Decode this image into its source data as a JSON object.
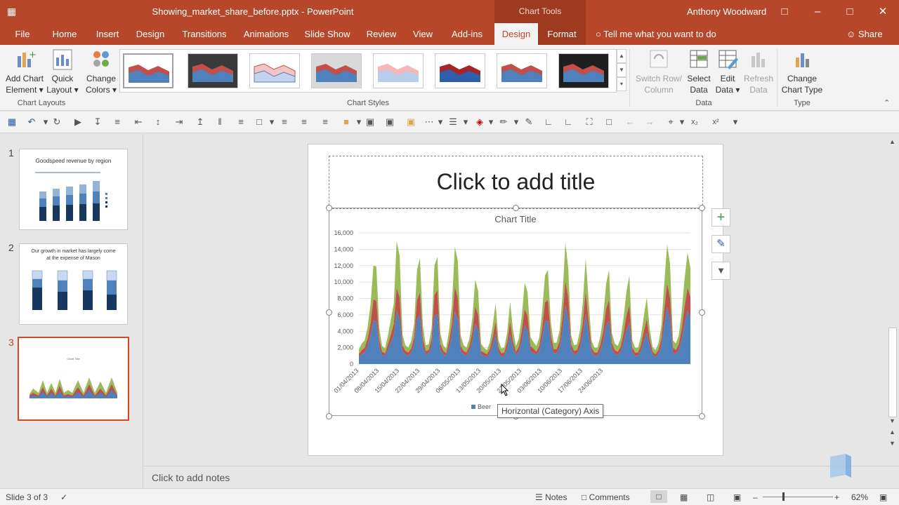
{
  "titlebar": {
    "doc_title": "Showing_market_share_before.pptx - PowerPoint",
    "contextual_group": "Chart Tools",
    "user": "Anthony Woodward",
    "save_icon": "save-icon",
    "accent": "#b7472a",
    "context_color": "#9e3a20"
  },
  "tabs": [
    {
      "label": "File"
    },
    {
      "label": "Home"
    },
    {
      "label": "Insert"
    },
    {
      "label": "Design"
    },
    {
      "label": "Transitions"
    },
    {
      "label": "Animations"
    },
    {
      "label": "Slide Show"
    },
    {
      "label": "Review"
    },
    {
      "label": "View"
    },
    {
      "label": "Add-ins"
    },
    {
      "label": "Design"
    },
    {
      "label": "Format"
    }
  ],
  "tell_me": "Tell me what you want to do",
  "share": "Share",
  "ribbon": {
    "add_chart_element": {
      "line1": "Add Chart",
      "line2": "Element ▾"
    },
    "quick_layout": {
      "line1": "Quick",
      "line2": "Layout ▾"
    },
    "change_colors": {
      "line1": "Change",
      "line2": "Colors ▾"
    },
    "group_chart_layouts": "Chart Layouts",
    "group_chart_styles": "Chart Styles",
    "switch_row_col": {
      "line1": "Switch Row/",
      "line2": "Column"
    },
    "select_data": {
      "line1": "Select",
      "line2": "Data"
    },
    "edit_data": {
      "line1": "Edit",
      "line2": "Data ▾"
    },
    "refresh_data": {
      "line1": "Refresh",
      "line2": "Data"
    },
    "group_data": "Data",
    "change_chart_type": {
      "line1": "Change",
      "line2": "Chart Type"
    },
    "group_type": "Type"
  },
  "slides": {
    "numbers": [
      "1",
      "2",
      "3"
    ],
    "s1_title": "Goodspeed revenue by region",
    "s2_title_l1": "Our growth in market has largely come",
    "s2_title_l2": "at the expense of Mason",
    "s3_title": "Chart Title"
  },
  "slide": {
    "title_placeholder": "Click to add title"
  },
  "chart_data": {
    "type": "area",
    "stacked": true,
    "title": "Chart Title",
    "ylim": [
      0,
      16000
    ],
    "yticks": [
      "0",
      "2,000",
      "4,000",
      "6,000",
      "8,000",
      "10,000",
      "12,000",
      "14,000",
      "16,000"
    ],
    "x_tick_labels": [
      "01/04/2013",
      "08/04/2013",
      "15/04/2013",
      "22/04/2013",
      "29/04/2013",
      "06/05/2013",
      "13/05/2013",
      "20/05/2013",
      "27/05/2013",
      "03/06/2013",
      "10/06/2013",
      "17/06/2013",
      "24/06/2013"
    ],
    "legend_visible": "Beer",
    "legend_position": "bottom",
    "series": [
      {
        "name": "Beer",
        "color": "#4f81bd",
        "values": [
          900,
          1200,
          1400,
          2200,
          3500,
          5300,
          5200,
          2000,
          1100,
          1000,
          1800,
          2600,
          3500,
          6500,
          5400,
          1500,
          1200,
          1000,
          1400,
          2400,
          5400,
          6000,
          2100,
          1200,
          1300,
          2200,
          5800,
          6100,
          1700,
          1200,
          1000,
          2000,
          3500,
          6400,
          5500,
          1500,
          1200,
          1000,
          1600,
          2800,
          4900,
          4200,
          1100,
          1000,
          900,
          1300,
          2300,
          3600,
          1400,
          900,
          1000,
          1900,
          3600,
          2000,
          1100,
          1500,
          2800,
          4700,
          4100,
          1500,
          1400,
          1100,
          1600,
          3000,
          5200,
          5300,
          2400,
          1300,
          1300,
          2000,
          3900,
          7100,
          5500,
          1700,
          1200,
          1200,
          2000,
          3500,
          6100,
          3600,
          1400,
          1000,
          1000,
          1600,
          2700,
          4600,
          5300,
          1800,
          1200,
          1100,
          1500,
          2600,
          4100,
          5000,
          1400,
          1000,
          1000,
          1600,
          2800,
          3800,
          2100,
          1100,
          900,
          1200,
          2200,
          4600,
          6900,
          5500,
          1400,
          1200,
          1700,
          3000,
          4900,
          6500,
          5600
        ]
      },
      {
        "name": "Series 2",
        "color": "#c0504d",
        "values": [
          300,
          500,
          600,
          900,
          1400,
          2600,
          2500,
          1000,
          400,
          300,
          600,
          1000,
          1400,
          2800,
          2700,
          800,
          400,
          400,
          500,
          900,
          2400,
          2700,
          1000,
          400,
          400,
          900,
          2600,
          2900,
          800,
          400,
          300,
          800,
          1400,
          3000,
          2600,
          700,
          400,
          400,
          600,
          1100,
          2100,
          1800,
          500,
          400,
          300,
          500,
          900,
          1600,
          600,
          400,
          400,
          800,
          1600,
          800,
          400,
          600,
          1200,
          2000,
          1800,
          700,
          500,
          400,
          600,
          1300,
          2300,
          2500,
          1100,
          500,
          500,
          800,
          1700,
          3000,
          2600,
          700,
          400,
          500,
          800,
          1500,
          2700,
          1700,
          600,
          400,
          400,
          700,
          1200,
          2100,
          2500,
          800,
          500,
          400,
          600,
          1100,
          1800,
          2200,
          600,
          400,
          400,
          700,
          1200,
          1700,
          900,
          400,
          300,
          500,
          900,
          2000,
          2900,
          2600,
          600,
          500,
          700,
          1300,
          2100,
          2800,
          2600
        ]
      },
      {
        "name": "Series 3",
        "color": "#9bbb59",
        "values": [
          600,
          800,
          900,
          1400,
          2400,
          4100,
          4200,
          1400,
          700,
          600,
          1100,
          1800,
          2500,
          5700,
          5100,
          1300,
          700,
          600,
          900,
          1600,
          3700,
          4200,
          1600,
          700,
          700,
          1300,
          3600,
          4100,
          1300,
          700,
          600,
          1300,
          2300,
          4900,
          4500,
          1300,
          700,
          600,
          900,
          1700,
          3300,
          2900,
          900,
          600,
          500,
          800,
          1500,
          2200,
          900,
          600,
          600,
          1200,
          2400,
          1400,
          700,
          1000,
          1800,
          3200,
          2900,
          1100,
          800,
          700,
          1000,
          2000,
          3300,
          3700,
          1600,
          800,
          800,
          1300,
          2600,
          4700,
          3600,
          1100,
          700,
          700,
          1300,
          2500,
          4100,
          2500,
          900,
          600,
          600,
          1000,
          1800,
          3000,
          3700,
          1200,
          800,
          700,
          1000,
          1900,
          2900,
          3600,
          900,
          600,
          600,
          1100,
          1900,
          2600,
          1300,
          600,
          500,
          800,
          1500,
          3100,
          4800,
          4100,
          900,
          800,
          1100,
          2000,
          3400,
          4300,
          3500
        ]
      }
    ]
  },
  "tooltip": "Horizontal (Category) Axis",
  "notes_placeholder": "Click to add notes",
  "status": {
    "slide_info": "Slide 3 of 3",
    "notes": "Notes",
    "comments": "Comments",
    "zoom": "62%"
  }
}
